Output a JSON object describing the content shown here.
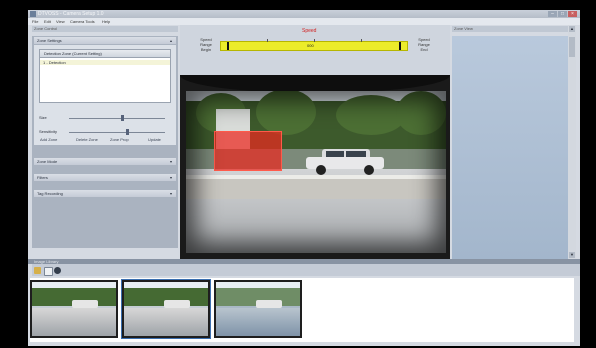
{
  "window": {
    "title": "DTVOSS - Camera Setup 1.0"
  },
  "menu": [
    "File",
    "Edit",
    "View",
    "Camera Tools",
    "Help"
  ],
  "panels": {
    "left_header": "Zone Control",
    "right_header": "Zone View",
    "bottom_header": "Image Library"
  },
  "zone_settings": {
    "section_title": "Zone Settings",
    "list_header": "Detection Zone (Current Setting)",
    "list_items": [
      "1 - Detection"
    ],
    "sliders": [
      {
        "label": "Size",
        "value": 0.55
      },
      {
        "label": "Sensitivity",
        "value": 0.6
      }
    ],
    "buttons": [
      "Add Zone",
      "Delete Zone",
      "Zone Prop",
      "Update"
    ]
  },
  "collapsed_sections": [
    "Zone Mode",
    "Filters",
    "Tag Recording"
  ],
  "speed_control": {
    "title": "Speed",
    "left_label": "Speed Range Begin",
    "right_label": "Speed Range End",
    "value_text": "000",
    "left_marker": 0.03,
    "right_marker": 0.97
  },
  "toolbar_icons": [
    "folder-icon",
    "image-icon",
    "camera-icon"
  ],
  "thumbnails": [
    {
      "selected": false
    },
    {
      "selected": true
    },
    {
      "selected": false
    }
  ],
  "colors": {
    "accent_yellow": "#ecec2a",
    "roi_red": "#eb281e",
    "title_red": "#d02020"
  }
}
